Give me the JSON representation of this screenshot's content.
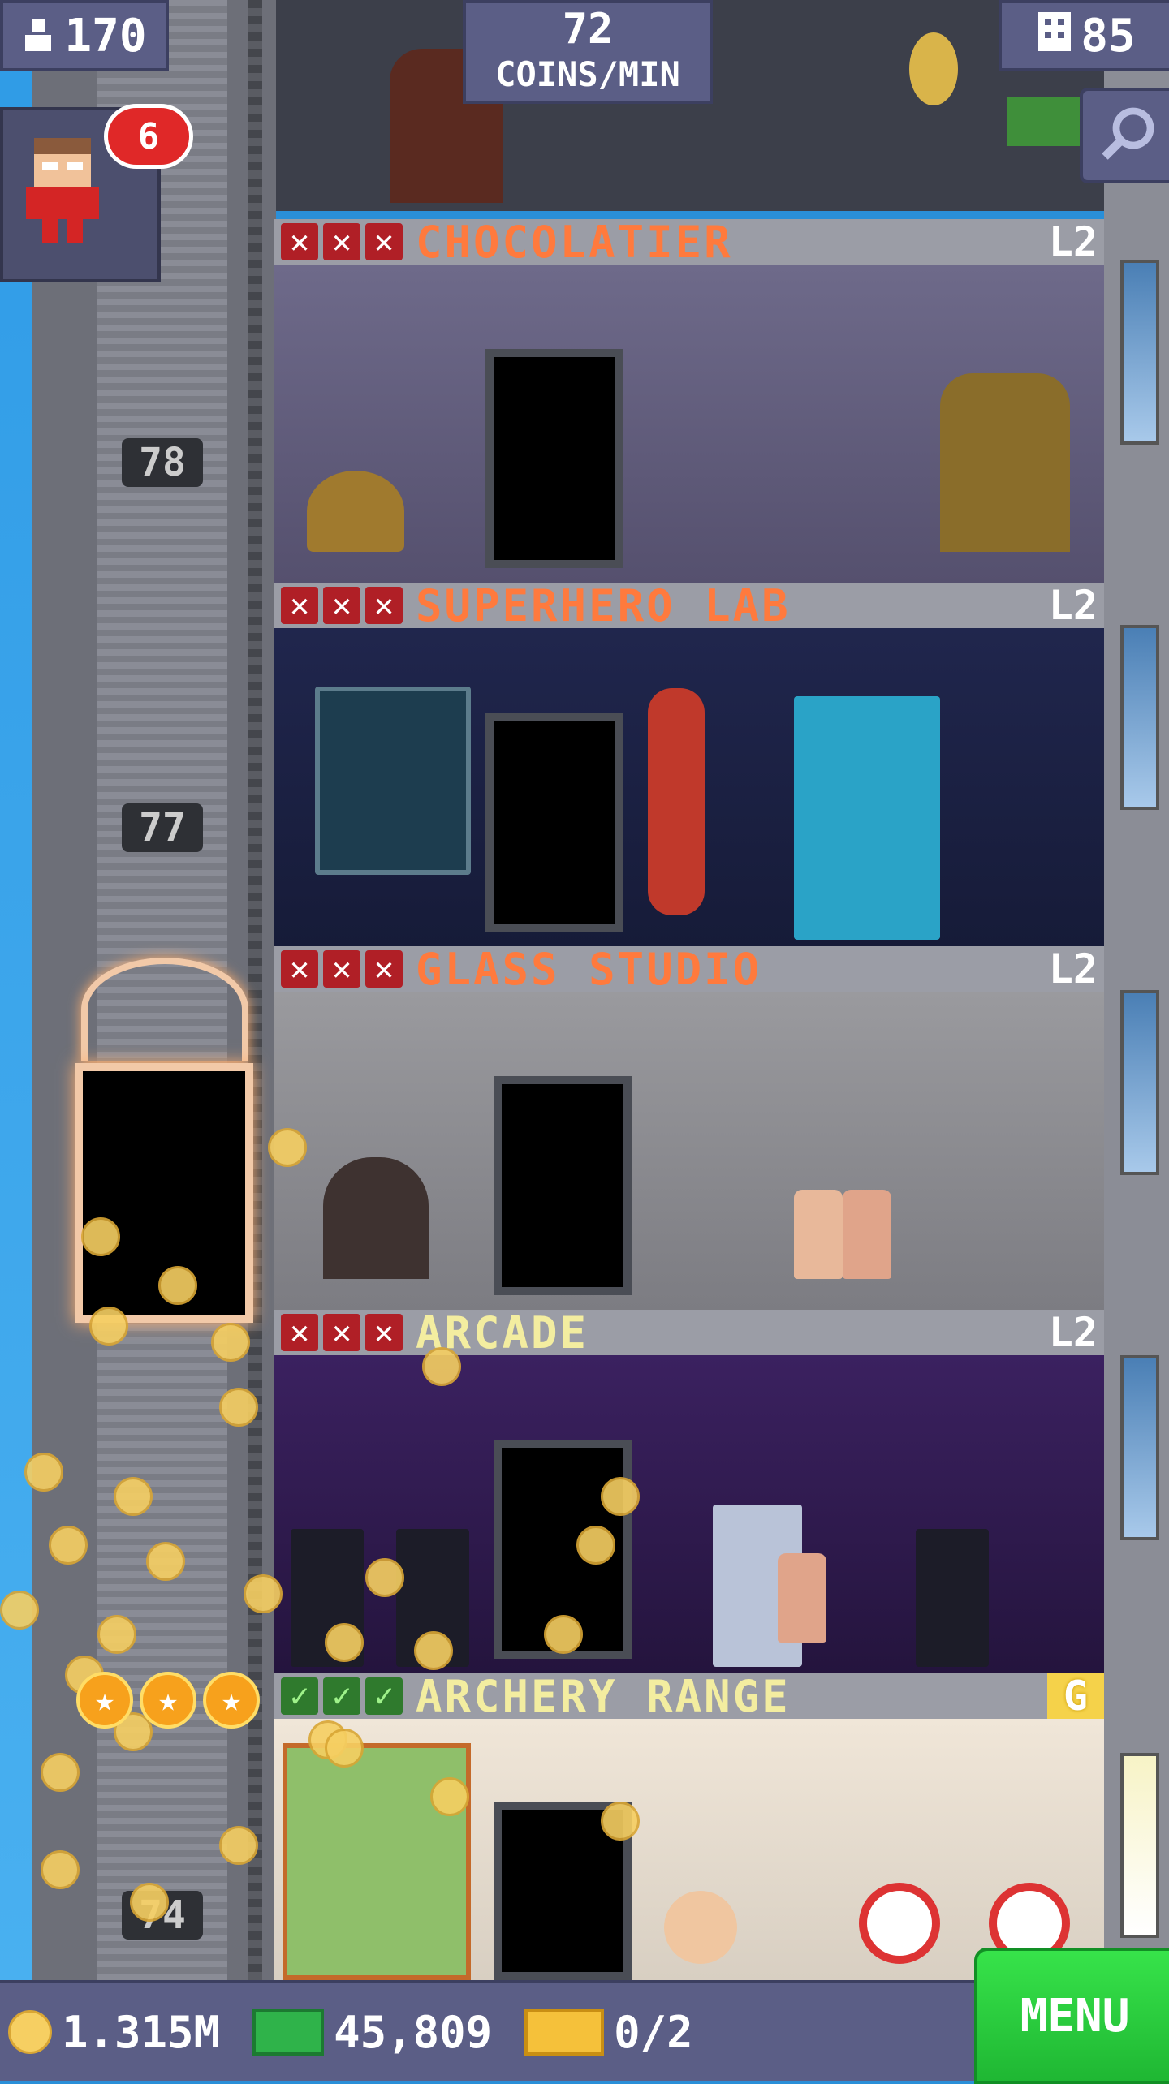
{
  "hud": {
    "population": "170",
    "coins_per_min_value": "72",
    "coins_per_min_label": "COINS/MIN",
    "floors": "85"
  },
  "notifications": {
    "count": "6"
  },
  "elevator": {
    "floor_numbers": [
      "78",
      "77",
      "74"
    ]
  },
  "floors": [
    {
      "name": "CHOCOLATIER",
      "level": "L2",
      "status": "incomplete"
    },
    {
      "name": "SUPERHERO LAB",
      "level": "L2",
      "status": "incomplete"
    },
    {
      "name": "GLASS STUDIO",
      "level": "L2",
      "status": "incomplete"
    },
    {
      "name": "ARCADE",
      "level": "L2",
      "status": "incomplete"
    },
    {
      "name": "ARCHERY RANGE",
      "level": "G",
      "status": "complete"
    }
  ],
  "resources": {
    "coins": "1.315M",
    "bux": "45,809",
    "tickets": "0/2"
  },
  "menu_label": "MENU",
  "colors": {
    "hud_bg": "#5b5e86",
    "floor_name_incomplete": "#ff7a3d",
    "floor_name_complete": "#f3eda0",
    "menu_green": "#2fd040",
    "coin_gold": "#f6cf62"
  },
  "icons": [
    "person-icon",
    "building-icon",
    "magnifier-icon",
    "x-mark-icon",
    "check-mark-icon",
    "coin-icon",
    "bux-icon",
    "ticket-icon",
    "star-icon"
  ]
}
